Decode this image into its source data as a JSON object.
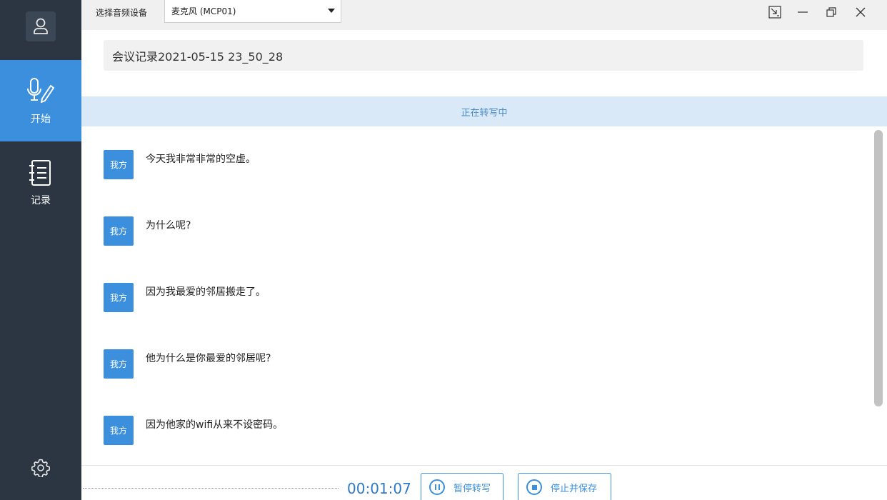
{
  "sidebar": {
    "nav": [
      {
        "label": "开始",
        "icon": "microphone-pen-icon",
        "active": true
      },
      {
        "label": "记录",
        "icon": "notebook-icon",
        "active": false
      }
    ],
    "settings_icon": "gear-icon",
    "avatar_icon": "user-icon"
  },
  "topbar": {
    "device_label": "选择音频设备",
    "device_selected": "麦克风 (MCP01)"
  },
  "meeting": {
    "title": "会议记录2021-05-15 23_50_28"
  },
  "status": {
    "text": "正在转写中"
  },
  "messages": [
    {
      "speaker": "我方",
      "text": "今天我非常非常的空虚。"
    },
    {
      "speaker": "我方",
      "text": "为什么呢?"
    },
    {
      "speaker": "我方",
      "text": "因为我最爱的邻居搬走了。"
    },
    {
      "speaker": "我方",
      "text": "他为什么是你最爱的邻居呢?"
    },
    {
      "speaker": "我方",
      "text": "因为他家的wifi从来不设密码。"
    }
  ],
  "controls": {
    "timer": "00:01:07",
    "pause_label": "暂停转写",
    "stop_label": "停止并保存"
  },
  "colors": {
    "sidebar_bg": "#2b3642",
    "accent": "#3b8fdc",
    "status_bg": "#d9e9f7"
  }
}
